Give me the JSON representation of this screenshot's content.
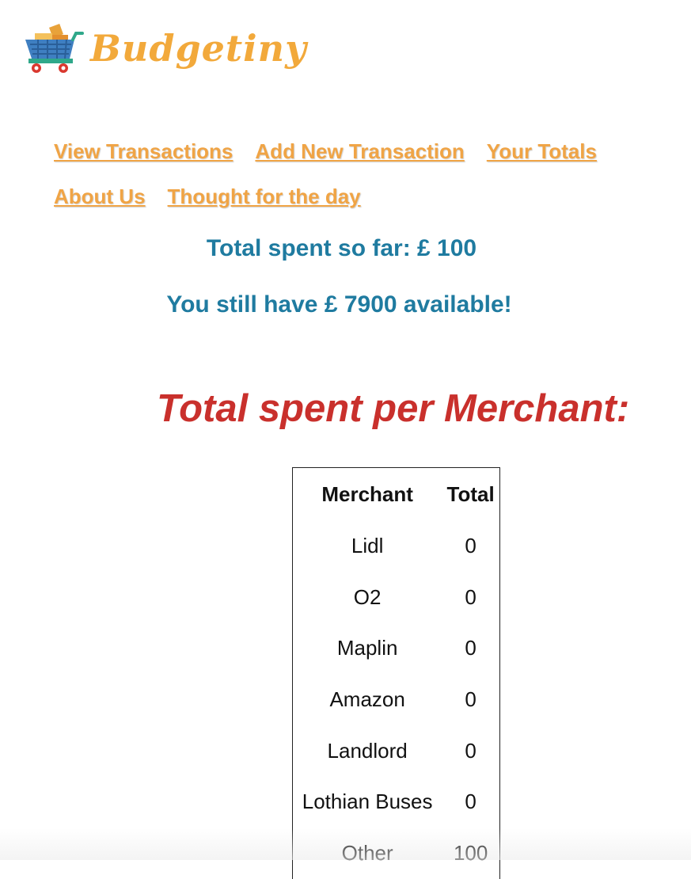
{
  "brand": {
    "name": "Budgetiny",
    "logo_icon": "shopping-cart-icon"
  },
  "nav": {
    "links": [
      {
        "label": "View Transactions"
      },
      {
        "label": "Add New Transaction"
      },
      {
        "label": "Your Totals"
      },
      {
        "label": "About Us"
      },
      {
        "label": "Thought for the day"
      }
    ]
  },
  "summary": {
    "spent_text": "Total spent so far: £ 100",
    "available_text": "You still have £ 7900 available!"
  },
  "merchants_section": {
    "title": "Total spent per Merchant:",
    "columns": [
      "Merchant",
      "Total"
    ],
    "rows": [
      {
        "merchant": "Lidl",
        "total": "0"
      },
      {
        "merchant": "O2",
        "total": "0"
      },
      {
        "merchant": "Maplin",
        "total": "0"
      },
      {
        "merchant": "Amazon",
        "total": "0"
      },
      {
        "merchant": "Landlord",
        "total": "0"
      },
      {
        "merchant": "Lothian Buses",
        "total": "0"
      },
      {
        "merchant": "Other",
        "total": "100"
      }
    ]
  },
  "colors": {
    "brand_orange": "#f2a93b",
    "nav_link": "#f0a445",
    "summary_blue": "#1f7ba0",
    "title_red": "#c9302c"
  }
}
